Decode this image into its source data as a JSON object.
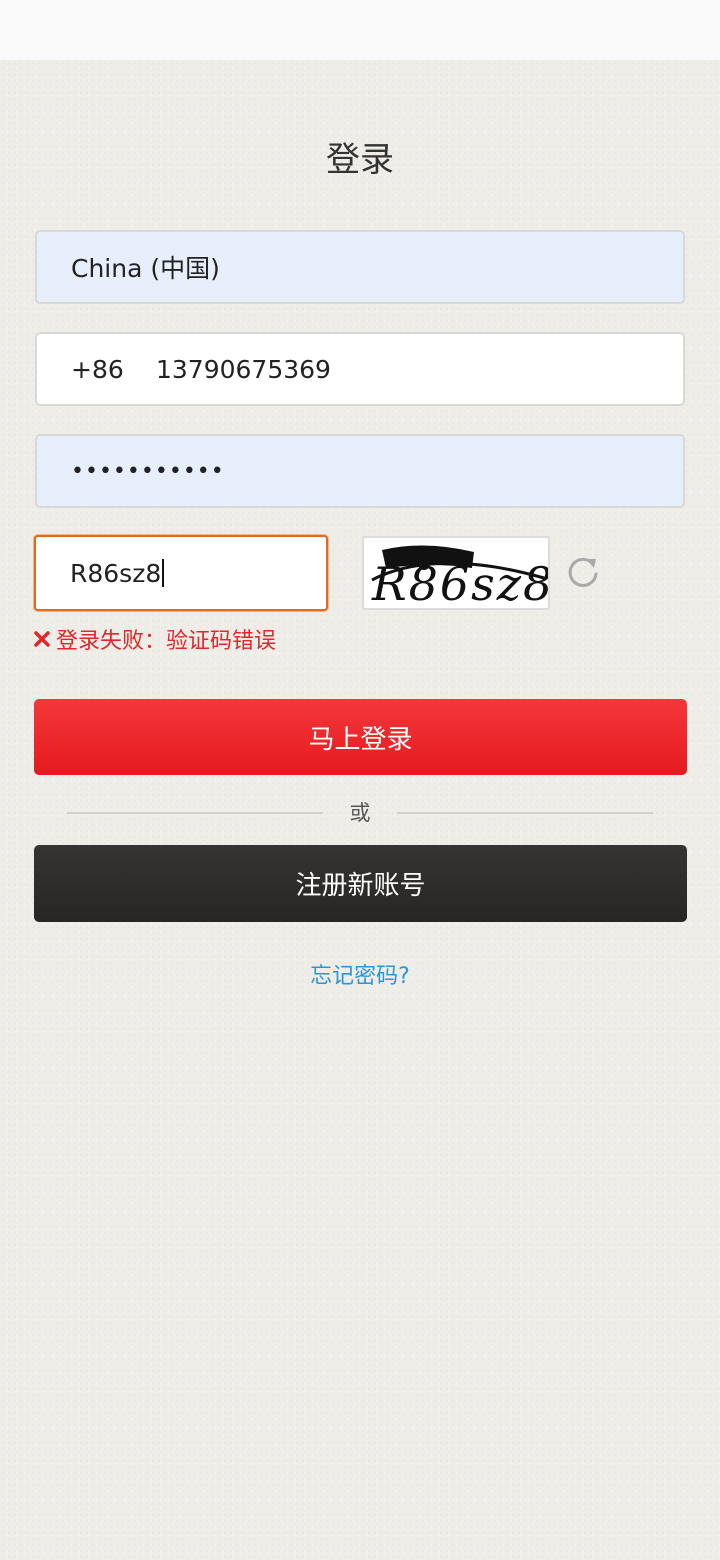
{
  "page": {
    "title": "登录"
  },
  "form": {
    "country": "China (中国)",
    "dial_code": "+86",
    "phone": "13790675369",
    "password_masked": "•••••••••••",
    "captcha_value": "R86sz8",
    "captcha_image_text": "R86sz8"
  },
  "error": {
    "message": "登录失败：验证码错误"
  },
  "buttons": {
    "login": "马上登录",
    "divider_text": "或",
    "register": "注册新账号",
    "forgot_password": "忘记密码?"
  },
  "colors": {
    "primary_red": "#e51a1f",
    "dark_button": "#2e2c2a",
    "link_blue": "#2b95d6",
    "error_red": "#e3262b",
    "focus_orange": "#e06a22",
    "autofill_blue": "#e8effc"
  },
  "icons": {
    "refresh": "refresh-icon",
    "error": "error-x-icon"
  }
}
